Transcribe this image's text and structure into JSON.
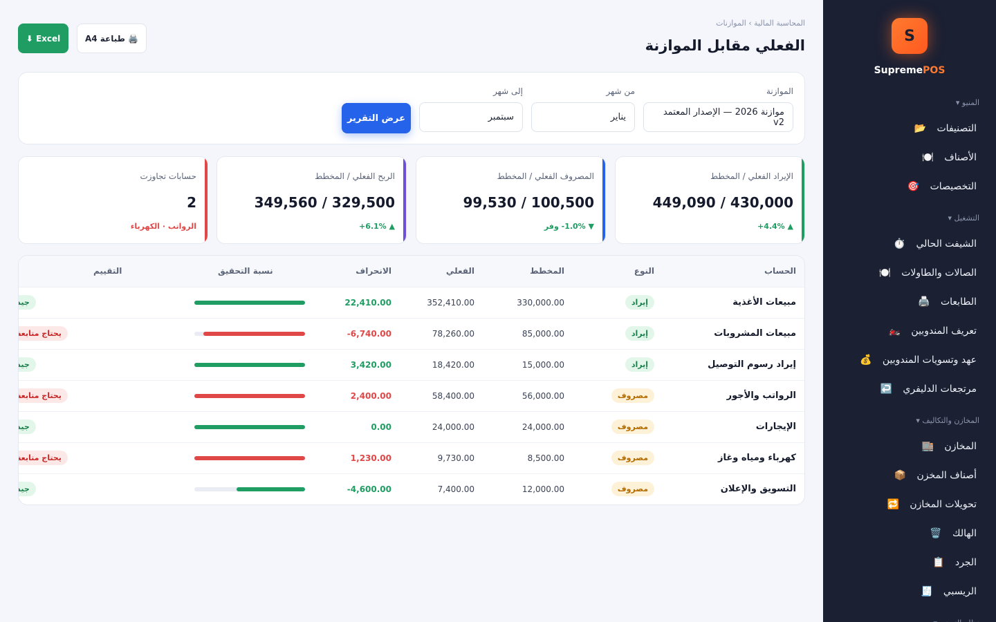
{
  "sidebar": {
    "logo_letter": "S",
    "brand_main": "Supreme",
    "brand_accent": "POS",
    "groups": [
      {
        "title": "المنيو ▾",
        "items": [
          {
            "label": "التصنيفات",
            "icon": "📂"
          },
          {
            "label": "الأصناف",
            "icon": "🍽️"
          },
          {
            "label": "التخصيصات",
            "icon": "🎯"
          }
        ]
      },
      {
        "title": "التشغيل ▾",
        "items": [
          {
            "label": "الشيفت الحالي",
            "icon": "⏱️"
          },
          {
            "label": "الصالات والطاولات",
            "icon": "🍽️"
          },
          {
            "label": "الطابعات",
            "icon": "🖨️"
          },
          {
            "label": "تعريف المندوبين",
            "icon": "🏍️"
          },
          {
            "label": "عهد وتسويات المندوبين",
            "icon": "💰"
          },
          {
            "label": "مرتجعات الدليفري",
            "icon": "↩️"
          }
        ]
      },
      {
        "title": "المخازن والتكاليف ▾",
        "items": [
          {
            "label": "المخازن",
            "icon": "🏬"
          },
          {
            "label": "أصناف المخزن",
            "icon": "📦"
          },
          {
            "label": "تحويلات المخازن",
            "icon": "🔁"
          },
          {
            "label": "الهالك",
            "icon": "🗑️"
          },
          {
            "label": "الجرد",
            "icon": "📋"
          },
          {
            "label": "الريسبي",
            "icon": "🧾"
          }
        ]
      },
      {
        "title": "نظام التصنيع ▾",
        "items": []
      }
    ]
  },
  "header": {
    "breadcrumb": "المحاسبة المالية › الموازنات",
    "title": "الفعلي مقابل الموازنة",
    "excel_label": "Excel ⬇",
    "print_label": "🖨️ طباعة A4"
  },
  "filters": {
    "budget_label": "الموازنة",
    "budget_value": "موازنة 2026 — الإصدار المعتمد v2",
    "from_label": "من شهر",
    "from_value": "يناير",
    "to_label": "إلى شهر",
    "to_value": "سبتمبر",
    "show_label": "عرض التقرير"
  },
  "kpis": [
    {
      "label": "الإيراد الفعلي / المخطط",
      "value": "430,000 / 449,090",
      "note": "▲ 4.4%+",
      "color": "#1f9d63",
      "note_color": "#1f9d63"
    },
    {
      "label": "المصروف الفعلي / المخطط",
      "value": "100,500 / 99,530",
      "note": "▼ 1.0%- وفر",
      "color": "#2563eb",
      "note_color": "#1f9d63"
    },
    {
      "label": "الربح الفعلي / المخطط",
      "value": "329,500 / 349,560",
      "note": "▲ 6.1%+",
      "color": "#6d4fd8",
      "note_color": "#1f9d63"
    },
    {
      "label": "حسابات تجاوزت",
      "value": "2",
      "note": "الرواتب · الكهرباء",
      "color": "#e04848",
      "note_color": "#e04848"
    }
  ],
  "table": {
    "headers": {
      "account": "الحساب",
      "type": "النوع",
      "planned": "المخطط",
      "actual": "الفعلي",
      "variance": "الانحراف",
      "ratio": "نسبة التحقيق",
      "rating": "التقييم"
    },
    "rows": [
      {
        "account": "مبيعات الأغذية",
        "type": "إيراد",
        "kind": "rev",
        "planned": "330,000.00",
        "actual": "352,410.00",
        "variance": "22,410.00",
        "var_color": "#1f9d63",
        "ratio": 1.0,
        "bar_color": "#1f9d63",
        "rating": "جيد",
        "rating_kind": "good"
      },
      {
        "account": "مبيعات المشروبات",
        "type": "إيراد",
        "kind": "rev",
        "planned": "85,000.00",
        "actual": "78,260.00",
        "variance": "6,740.00-",
        "var_color": "#e04848",
        "ratio": 0.92,
        "bar_color": "#e04848",
        "rating": "يحتاج متابعة",
        "rating_kind": "warn"
      },
      {
        "account": "إيراد رسوم التوصيل",
        "type": "إيراد",
        "kind": "rev",
        "planned": "15,000.00",
        "actual": "18,420.00",
        "variance": "3,420.00",
        "var_color": "#1f9d63",
        "ratio": 1.0,
        "bar_color": "#1f9d63",
        "rating": "جيد",
        "rating_kind": "good"
      },
      {
        "account": "الرواتب والأجور",
        "type": "مصروف",
        "kind": "exp",
        "planned": "56,000.00",
        "actual": "58,400.00",
        "variance": "2,400.00",
        "var_color": "#e04848",
        "ratio": 1.0,
        "bar_color": "#e04848",
        "rating": "يحتاج متابعة",
        "rating_kind": "warn"
      },
      {
        "account": "الإيجارات",
        "type": "مصروف",
        "kind": "exp",
        "planned": "24,000.00",
        "actual": "24,000.00",
        "variance": "0.00",
        "var_color": "#1f9d63",
        "ratio": 1.0,
        "bar_color": "#1f9d63",
        "rating": "جيد",
        "rating_kind": "good"
      },
      {
        "account": "كهرباء ومياه وغاز",
        "type": "مصروف",
        "kind": "exp",
        "planned": "8,500.00",
        "actual": "9,730.00",
        "variance": "1,230.00",
        "var_color": "#e04848",
        "ratio": 1.0,
        "bar_color": "#e04848",
        "rating": "يحتاج متابعة",
        "rating_kind": "warn"
      },
      {
        "account": "التسويق والإعلان",
        "type": "مصروف",
        "kind": "exp",
        "planned": "12,000.00",
        "actual": "7,400.00",
        "variance": "4,600.00-",
        "var_color": "#1f9d63",
        "ratio": 0.62,
        "bar_color": "#1f9d63",
        "rating": "جيد",
        "rating_kind": "good"
      }
    ]
  }
}
